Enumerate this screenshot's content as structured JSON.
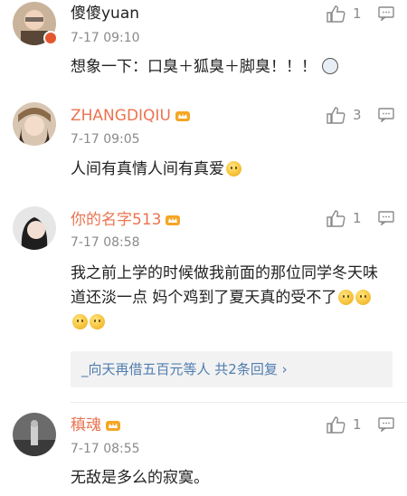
{
  "comments": [
    {
      "username": "傻傻yuan",
      "time": "7-17 09:10",
      "text": "想象一下：口臭＋狐臭＋脚臭！！！",
      "likes": "1"
    },
    {
      "username": "ZHANGDIQIU",
      "time": "7-17 09:05",
      "text": "人间有真情人间有真爱",
      "likes": "3"
    },
    {
      "username": "你的名字513",
      "time": "7-17 08:58",
      "text": "我之前上学的时候做我前面的那位同学冬天味道还淡一点 妈个鸡到了夏天真的受不了",
      "likes": "1",
      "replies": "_向天再借五百元等人 共2条回复 ›"
    },
    {
      "username": "稹魂",
      "time": "7-17 08:55",
      "text": "无敌是多么的寂寞。",
      "likes": "1"
    }
  ],
  "colors": {
    "orange_name": "#eb7350",
    "link_blue": "#507daf",
    "gray_text": "#8a8a8a"
  },
  "icons": [
    "thumbs-up-icon",
    "comment-reply-icon",
    "level-crown-icon",
    "emoji-smile-icon"
  ]
}
